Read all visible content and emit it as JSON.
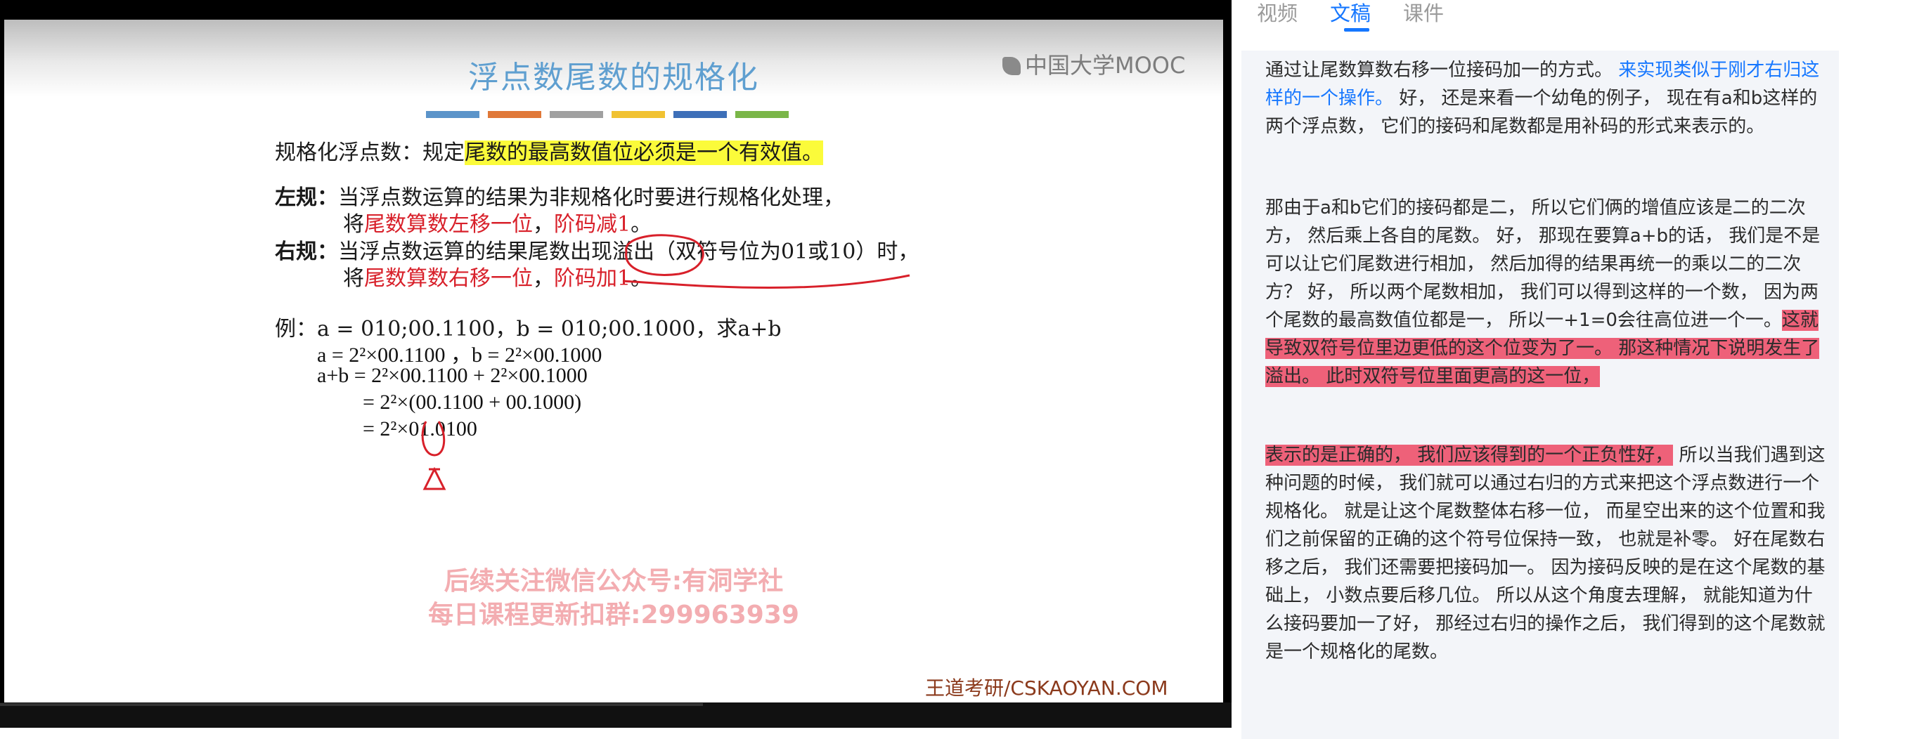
{
  "slide": {
    "title": "浮点数尾数的规格化",
    "logo": "中国大学MOOC",
    "color_bars": [
      "#5b94c9",
      "#e07838",
      "#a0a0a0",
      "#f1c232",
      "#3d6fb8",
      "#7ab648"
    ],
    "line1_a": "规格化浮点数：规定",
    "line1_hl": "尾数的最高数值位必须是一个有效值",
    "line1_b": "。",
    "left_label": "左规：",
    "left_text1": "当浮点数运算的结果为非规格化时要进行规格化处理，",
    "left_text2a": "将",
    "left_text2b": "尾数算数左移一位",
    "left_text2c": "，",
    "left_text2d": "阶码减1",
    "left_text2e": "。",
    "right_label": "右规：",
    "right_text1": "当浮点数运算的结果尾数出现溢出（双符号位为01或10）时，",
    "right_text2a": "将",
    "right_text2b": "尾数算数右移一位",
    "right_text2c": "，",
    "right_text2d": "阶码加1",
    "right_text2e": "。",
    "example": "例：a = 010;00.1100，b = 010;00.1000，求a+b",
    "eq1": "a  =  2²×00.1100 ，b = 2²×00.1000",
    "eq2": "a+b  =  2²×00.1100  +  2²×00.1000",
    "eq3": "=  2²×(00.1100 + 00.1000)",
    "eq4": "=  2²×01.0100",
    "watermark1": "后续关注微信公众号:有洞学社",
    "watermark2": "每日课程更新扣群:299963939",
    "site": "王道考研/CSKAOYAN.COM"
  },
  "tabs": [
    {
      "label": "视频",
      "active": false
    },
    {
      "label": "文稿",
      "active": true
    },
    {
      "label": "课件",
      "active": false
    }
  ],
  "transcript": {
    "p1_a": "通过让尾数算数右移一位接码加一的方式。",
    "p1_link": "来实现类似于刚才右归这样的一个操作。",
    "p1_b": "好， 还是来看一个幼龟的例子， 现在有a和b这样的两个浮点数， 它们的接码和尾数都是用补码的形式来表示的。",
    "p2_a": "那由于a和b它们的接码都是二， 所以它们俩的增值应该是二的二次方， 然后乘上各自的尾数。 好， 那现在要算a+b的话， 我们是不是可以让它们尾数进行相加， 然后加得的结果再统一的乘以二的二次方？ 好， 所以两个尾数相加， 我们可以得到这样的一个数， 因为两个尾数的最高数值位都是一， 所以一+1=0会往高位进一个一。",
    "p2_hl": "这就导致双符号位里边更低的这个位变为了一。 那这种情况下说明发生了溢出。 此时双符号位里面更高的这一位，",
    "p3_hl": "表示的是正确的， 我们应该得到的一个正负性好，",
    "p3_b": "所以当我们遇到这种问题的时候， 我们就可以通过右归的方式来把这个浮点数进行一个规格化。 就是让这个尾数整体右移一位， 而星空出来的这个位置和我们之前保留的正确的这个符号位保持一致， 也就是补零。 好在尾数右移之后， 我们还需要把接码加一。 因为接码反映的是在这个尾数的基础上， 小数点要后移几位。 所以从这个角度去理解， 就能知道为什么接码要加一了好， 那经过右归的操作之后， 我们得到的这个尾数就是一个规格化的尾数。"
  }
}
